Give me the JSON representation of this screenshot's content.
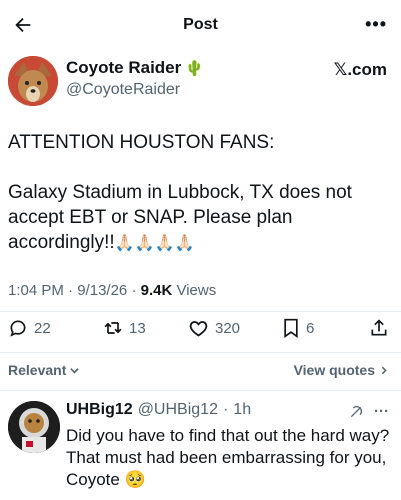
{
  "header": {
    "title": "Post"
  },
  "author": {
    "name": "Coyote Raider",
    "name_emoji": "🌵",
    "handle": "@CoyoteRaider",
    "source": "𝕏.com"
  },
  "tweet": {
    "line1": "ATTENTION HOUSTON FANS:",
    "line2": "Galaxy Stadium in Lubbock, TX does not accept EBT or SNAP. Please plan accordingly!!",
    "emojis": "🙏🏻🙏🏻🙏🏻🙏🏻"
  },
  "meta": {
    "time": "1:04 PM",
    "date": "9/13/26",
    "views_count": "9.4K",
    "views_label": "Views"
  },
  "actions": {
    "replies": "22",
    "retweets": "13",
    "likes": "320",
    "bookmarks": "6"
  },
  "sort": {
    "relevant": "Relevant",
    "view_quotes": "View quotes"
  },
  "reply": {
    "name": "UHBig12",
    "handle": "@UHBig12",
    "time": "1h",
    "text": "Did you have to find that out the hard way? That must had been embarrassing for you, Coyote 🥺"
  },
  "colors": {
    "text": "#0f1419",
    "muted": "#536471",
    "divider": "#e6ecf0"
  }
}
